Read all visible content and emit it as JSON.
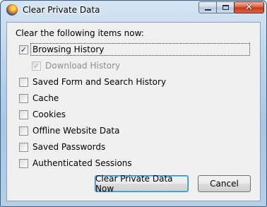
{
  "window": {
    "title": "Clear Private Data",
    "close_glyph": "✕"
  },
  "heading": "Clear the following items now:",
  "items": [
    {
      "label": "Browsing History",
      "checked": true,
      "disabled": false
    },
    {
      "label": "Download History",
      "checked": true,
      "disabled": true
    },
    {
      "label": "Saved Form and Search History",
      "checked": false,
      "disabled": false
    },
    {
      "label": "Cache",
      "checked": false,
      "disabled": false
    },
    {
      "label": "Cookies",
      "checked": false,
      "disabled": false
    },
    {
      "label": "Offline Website Data",
      "checked": false,
      "disabled": false
    },
    {
      "label": "Saved Passwords",
      "checked": false,
      "disabled": false
    },
    {
      "label": "Authenticated Sessions",
      "checked": false,
      "disabled": false
    }
  ],
  "check_glyph": "✓",
  "buttons": {
    "clear": "Clear Private Data Now",
    "cancel": "Cancel"
  },
  "icons": {
    "app": "firefox-icon",
    "minimize": "minimize-icon",
    "maximize": "maximize-icon",
    "close": "close-icon"
  }
}
